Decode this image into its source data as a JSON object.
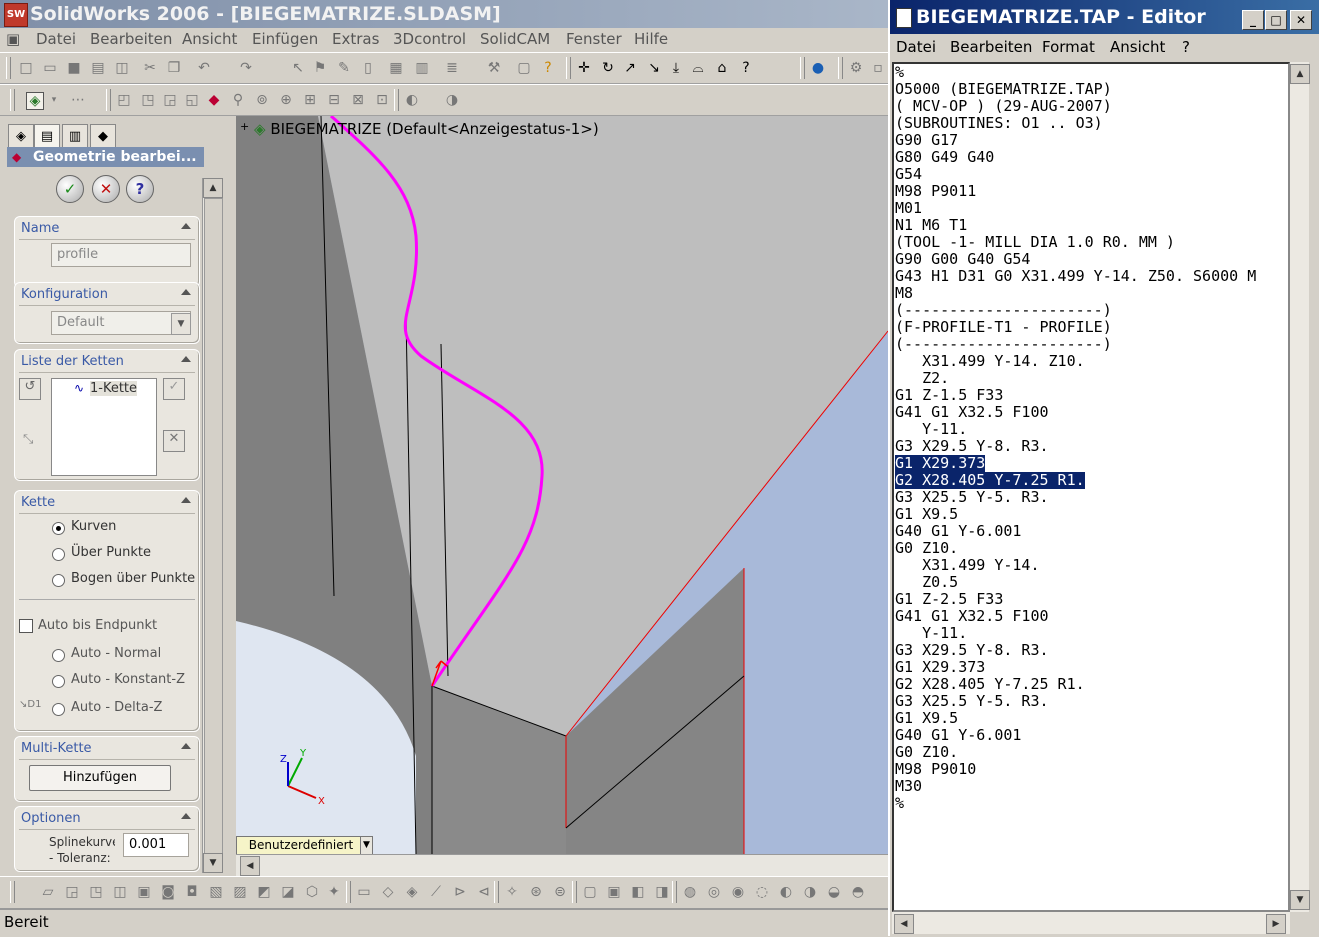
{
  "sw": {
    "title": "SolidWorks 2006 - [BIEGEMATRIZE.SLDASM]",
    "logo": "SW",
    "menu": [
      "Datei",
      "Bearbeiten",
      "Ansicht",
      "Einfügen",
      "Extras",
      "3Dcontrol",
      "SolidCAM",
      "Fenster",
      "Hilfe"
    ],
    "status": "Bereit"
  },
  "pm": {
    "header": "Geometrie bearbei...",
    "name_group": {
      "title": "Name",
      "value": "profile"
    },
    "config_group": {
      "title": "Konfiguration",
      "value": "Default"
    },
    "chains_group": {
      "title": "Liste der Ketten",
      "item": "1-Kette"
    },
    "chain_group": {
      "title": "Kette",
      "options": [
        "Kurven",
        "Über Punkte",
        "Bogen über Punkte"
      ],
      "auto_checkbox": "Auto bis Endpunkt",
      "auto_options": [
        "Auto - Normal",
        "Auto - Konstant-Z",
        "Auto - Delta-Z"
      ]
    },
    "multi_group": {
      "title": "Multi-Kette",
      "button": "Hinzufügen"
    },
    "options_group": {
      "title": "Optionen",
      "spline_label_1": "Splinekurve",
      "spline_label_2": "- Toleranz:",
      "spline_value": "0.001"
    }
  },
  "viewport": {
    "tree_label": "BIEGEMATRIZE  (Default<Anzeigestatus-1>)",
    "view_orient": "Benutzerdefiniert",
    "triad": {
      "x": "X",
      "y": "Y",
      "z": "Z"
    }
  },
  "editor": {
    "title": "BIEGEMATRIZE.TAP - Editor",
    "menu": [
      "Datei",
      "Bearbeiten",
      "Format",
      "Ansicht",
      "?"
    ],
    "lines": [
      "%",
      "O5000 (BIEGEMATRIZE.TAP)",
      "( MCV-OP ) (29-AUG-2007)",
      "(SUBROUTINES: O1 .. O3)",
      "G90 G17",
      "G80 G49 G40",
      "G54",
      "M98 P9011",
      "M01",
      "N1 M6 T1",
      "(TOOL -1- MILL DIA 1.0 R0. MM )",
      "G90 G00 G40 G54",
      "G43 H1 D31 G0 X31.499 Y-14. Z50. S6000 M",
      "M8",
      "(----------------------)",
      "(F-PROFILE-T1 - PROFILE)",
      "(----------------------)",
      "   X31.499 Y-14. Z10.",
      "   Z2.",
      "G1 Z-1.5 F33",
      "G41 G1 X32.5 F100",
      "   Y-11.",
      "G3 X29.5 Y-8. R3.",
      "G1 X29.373",
      "G2 X28.405 Y-7.25 R1.",
      "G3 X25.5 Y-5. R3.",
      "G1 X9.5",
      "G40 G1 Y-6.001",
      "G0 Z10.",
      "   X31.499 Y-14.",
      "   Z0.5",
      "G1 Z-2.5 F33",
      "G41 G1 X32.5 F100",
      "   Y-11.",
      "G3 X29.5 Y-8. R3.",
      "G1 X29.373",
      "G2 X28.405 Y-7.25 R1.",
      "G3 X25.5 Y-5. R3.",
      "G1 X9.5",
      "G40 G1 Y-6.001",
      "G0 Z10.",
      "M98 P9010",
      "M30",
      "%"
    ],
    "selected_lines": [
      23,
      24
    ]
  },
  "colors": {
    "selection": "#0a246a",
    "profile": "#ff00ff",
    "editor_title": "#0a246a"
  }
}
